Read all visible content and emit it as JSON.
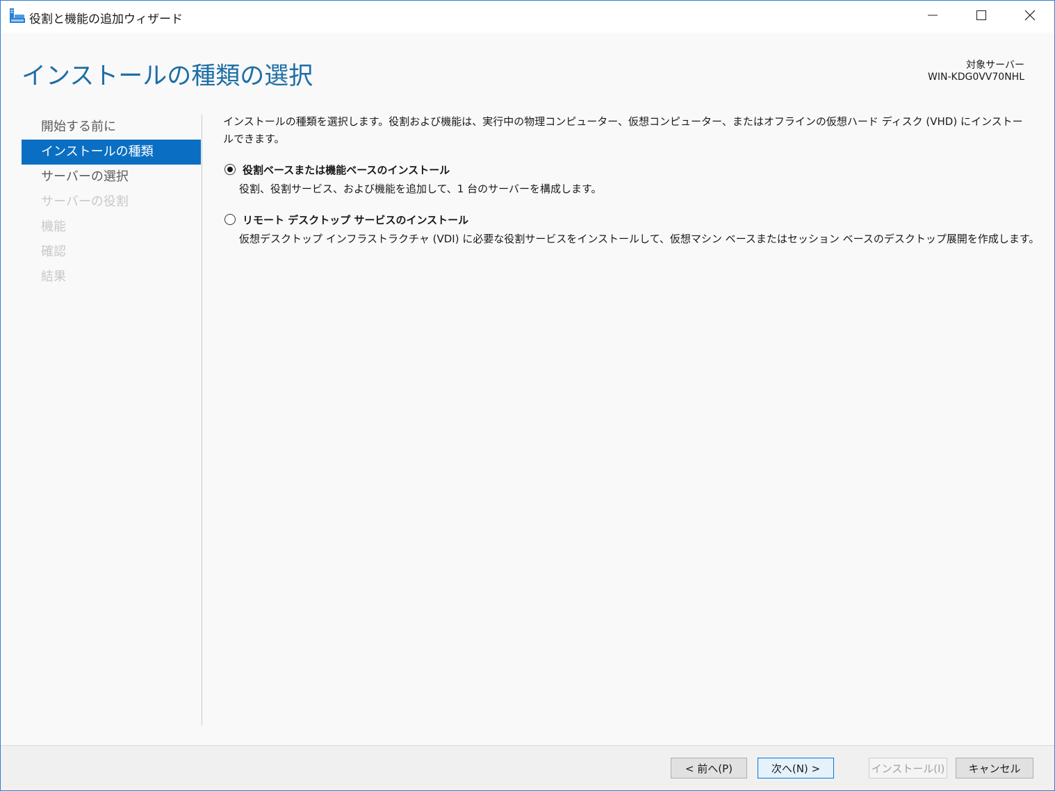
{
  "window": {
    "title": "役割と機能の追加ウィザード"
  },
  "header": {
    "page_title": "インストールの種類の選択",
    "target_server_label": "対象サーバー",
    "target_server_name": "WIN-KDG0VV70NHL"
  },
  "sidebar": {
    "items": [
      {
        "label": "開始する前に",
        "state": "normal"
      },
      {
        "label": "インストールの種類",
        "state": "active"
      },
      {
        "label": "サーバーの選択",
        "state": "normal"
      },
      {
        "label": "サーバーの役割",
        "state": "disabled"
      },
      {
        "label": "機能",
        "state": "disabled"
      },
      {
        "label": "確認",
        "state": "disabled"
      },
      {
        "label": "結果",
        "state": "disabled"
      }
    ]
  },
  "main": {
    "description": "インストールの種類を選択します。役割および機能は、実行中の物理コンピューター、仮想コンピューター、またはオフラインの仮想ハード ディスク (VHD) にインストールできます。",
    "options": [
      {
        "label": "役割ベースまたは機能ベースのインストール",
        "description": "役割、役割サービス、および機能を追加して、1 台のサーバーを構成します。",
        "selected": true
      },
      {
        "label": "リモート デスクトップ サービスのインストール",
        "description": "仮想デスクトップ インフラストラクチャ (VDI) に必要な役割サービスをインストールして、仮想マシン ベースまたはセッション ベースのデスクトップ展開を作成します。",
        "selected": false
      }
    ]
  },
  "footer": {
    "prev_label": "< 前へ(P)",
    "next_label": "次へ(N) >",
    "install_label": "インストール(I)",
    "cancel_label": "キャンセル"
  },
  "colors": {
    "accent": "#0a6fc2",
    "title_blue": "#1d6ea6"
  }
}
